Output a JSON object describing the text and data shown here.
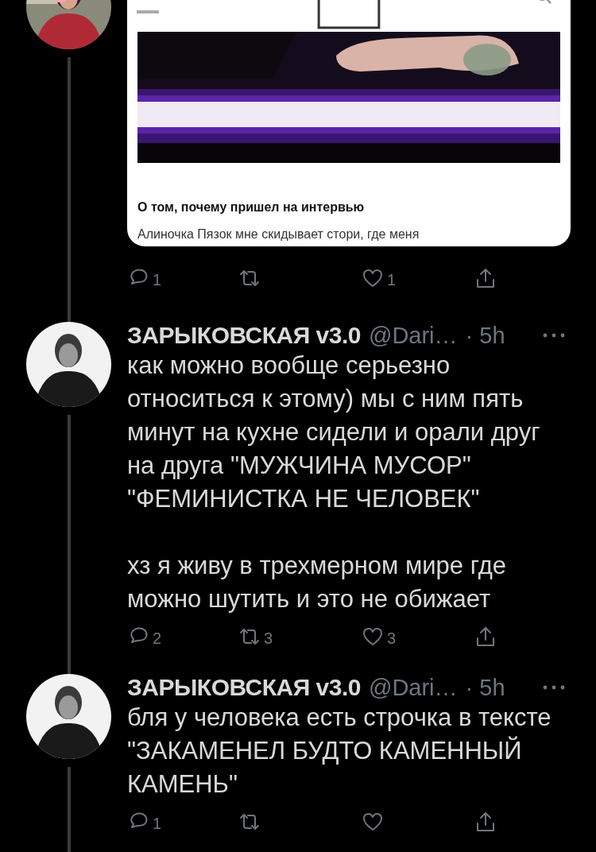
{
  "tweets": [
    {
      "avatar": {
        "kind": "picture"
      },
      "card": {
        "title": "О том, почему пришел на интервью",
        "excerpt": "Алиночка Пязок мне скидывает стори, где меня"
      },
      "actions": [
        {
          "kind": "reply",
          "count": "1"
        },
        {
          "kind": "retweet"
        },
        {
          "kind": "like",
          "count": "1"
        },
        {
          "kind": "share"
        }
      ]
    },
    {
      "avatar": {
        "kind": "picture"
      },
      "name": "ЗАРЫКОВСКАЯ v3.0",
      "handle": "@Dari…",
      "time": "· 5h",
      "paragraphs": [
        "как можно вообще серьезно относиться к этому) мы с ним пять минут на кухне сидели и орали друг на друга \"МУЖЧИНА МУСОР\" \"ФЕМИНИСТКА НЕ ЧЕЛОВЕК\"",
        "хз я живу в трехмерном мире где можно шутить и это не обижает"
      ],
      "actions": [
        {
          "kind": "reply",
          "count": "2"
        },
        {
          "kind": "retweet",
          "count": "3"
        },
        {
          "kind": "like",
          "count": "3"
        },
        {
          "kind": "share"
        }
      ]
    },
    {
      "avatar": {
        "kind": "picture"
      },
      "name": "ЗАРЫКОВСКАЯ v3.0",
      "handle": "@Dari…",
      "time": "· 5h",
      "paragraphs": [
        "бля у человека есть строчка в тексте \"ЗАКАМЕНЕЛ БУДТО КАМЕННЫЙ КАМЕНЬ\""
      ],
      "actions": [
        {
          "kind": "reply",
          "count": "1"
        },
        {
          "kind": "retweet"
        },
        {
          "kind": "like"
        },
        {
          "kind": "share"
        }
      ]
    }
  ]
}
